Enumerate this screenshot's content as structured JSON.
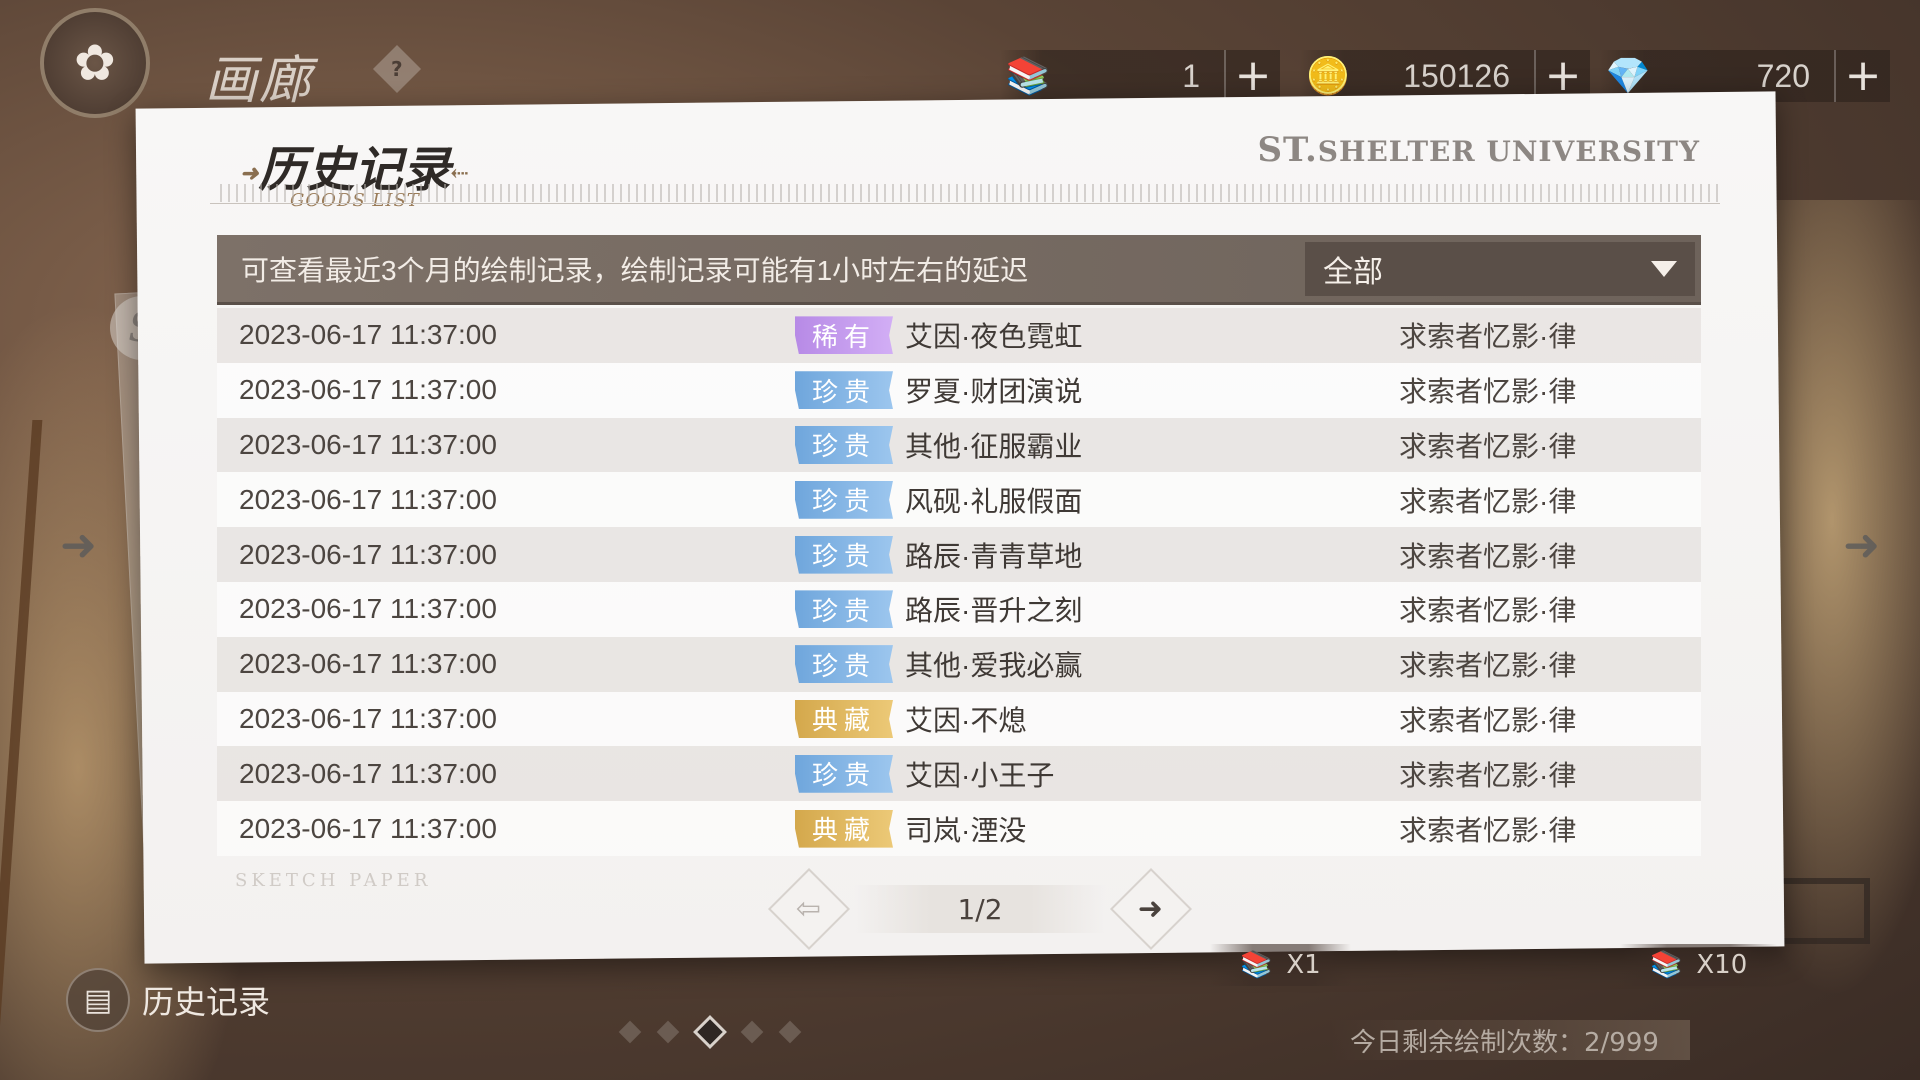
{
  "top": {
    "title": "画廊",
    "help": "?",
    "currencies": [
      {
        "icon": "paint-ticket-icon",
        "value": "1"
      },
      {
        "icon": "coin-icon",
        "value": "150126"
      },
      {
        "icon": "gem-icon",
        "value": "720"
      }
    ],
    "plus": "+"
  },
  "panel": {
    "title": "历史记录",
    "subtitle": "GOODS LIST",
    "brand_st": "ST.",
    "brand_rest": "SHELTER UNIVERSITY",
    "notice": "可查看最近3个月的绘制记录，绘制记录可能有1小时左右的延迟",
    "filter_value": "全部",
    "watermark": "SKETCH PAPER"
  },
  "records": [
    {
      "time": "2023-06-17  11:37:00",
      "rarity": "稀有",
      "rarity_color": "purple",
      "name": "艾因·夜色霓虹",
      "pool": "求索者忆影·律"
    },
    {
      "time": "2023-06-17  11:37:00",
      "rarity": "珍贵",
      "rarity_color": "blue",
      "name": "罗夏·财团演说",
      "pool": "求索者忆影·律"
    },
    {
      "time": "2023-06-17  11:37:00",
      "rarity": "珍贵",
      "rarity_color": "blue",
      "name": "其他·征服霸业",
      "pool": "求索者忆影·律"
    },
    {
      "time": "2023-06-17  11:37:00",
      "rarity": "珍贵",
      "rarity_color": "blue",
      "name": "风砚·礼服假面",
      "pool": "求索者忆影·律"
    },
    {
      "time": "2023-06-17  11:37:00",
      "rarity": "珍贵",
      "rarity_color": "blue",
      "name": "路辰·青青草地",
      "pool": "求索者忆影·律"
    },
    {
      "time": "2023-06-17  11:37:00",
      "rarity": "珍贵",
      "rarity_color": "blue",
      "name": "路辰·晋升之刻",
      "pool": "求索者忆影·律"
    },
    {
      "time": "2023-06-17  11:37:00",
      "rarity": "珍贵",
      "rarity_color": "blue",
      "name": "其他·爱我必赢",
      "pool": "求索者忆影·律"
    },
    {
      "time": "2023-06-17  11:37:00",
      "rarity": "典藏",
      "rarity_color": "gold",
      "name": "艾因·不熄",
      "pool": "求索者忆影·律"
    },
    {
      "time": "2023-06-17  11:37:00",
      "rarity": "珍贵",
      "rarity_color": "blue",
      "name": "艾因·小王子",
      "pool": "求索者忆影·律"
    },
    {
      "time": "2023-06-17  11:37:00",
      "rarity": "典藏",
      "rarity_color": "gold",
      "name": "司岚·湮没",
      "pool": "求索者忆影·律"
    }
  ],
  "pager": {
    "page": "1/2",
    "prev_disabled": true
  },
  "bottom": {
    "history_label": "历史记录",
    "draw_x1": "X1",
    "draw_x10": "X10",
    "remaining": "今日剩余绘制次数：2/999",
    "dots_total": 5,
    "dots_active": 2
  },
  "colors": {
    "purple": "#b78ae6",
    "blue": "#6fa6dc",
    "gold": "#d4a84c",
    "header_bar": "#7d7168"
  }
}
